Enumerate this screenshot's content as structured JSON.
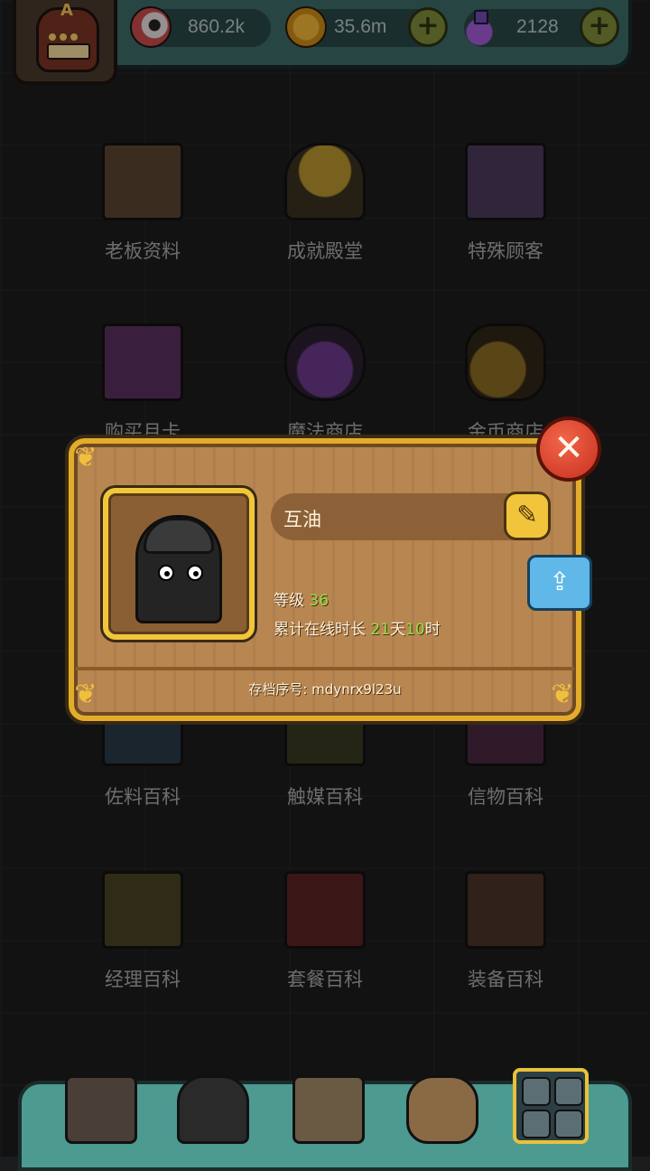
{
  "currencies": [
    {
      "icon": "eyeball-icon",
      "value": "860.2k"
    },
    {
      "icon": "coin-icon",
      "value": "35.6m"
    },
    {
      "icon": "potion-icon",
      "value": "2128"
    }
  ],
  "badge": {
    "letter": "A"
  },
  "menu": [
    {
      "label": "老板资料",
      "icon": "id-card-icon"
    },
    {
      "label": "成就殿堂",
      "icon": "trophy-icon"
    },
    {
      "label": "特殊顾客",
      "icon": "customer-card-icon"
    },
    {
      "label": "购买月卡",
      "icon": "monthly-card-icon"
    },
    {
      "label": "魔法商店",
      "icon": "magic-potions-icon"
    },
    {
      "label": "金币商店",
      "icon": "gold-coins-icon"
    },
    {
      "label": "佐料百科",
      "icon": "seasoning-book-icon"
    },
    {
      "label": "触媒百科",
      "icon": "catalyst-book-icon"
    },
    {
      "label": "信物百科",
      "icon": "token-book-icon"
    },
    {
      "label": "经理百科",
      "icon": "manager-book-icon"
    },
    {
      "label": "套餐百科",
      "icon": "meal-book-icon"
    },
    {
      "label": "装备百科",
      "icon": "equipment-book-icon"
    }
  ],
  "profile": {
    "name": "互油",
    "level_label": "等级",
    "level_value": "36",
    "online_label": "累计在线时长",
    "online_days": "21",
    "days_unit": "天",
    "online_hours": "10",
    "hours_unit": "时",
    "archive_label": "存档序号: mdynrx9l23u"
  },
  "colors": {
    "highlight": "#8fe04a",
    "frame": "#e3ad2b",
    "close": "#d8402a"
  }
}
